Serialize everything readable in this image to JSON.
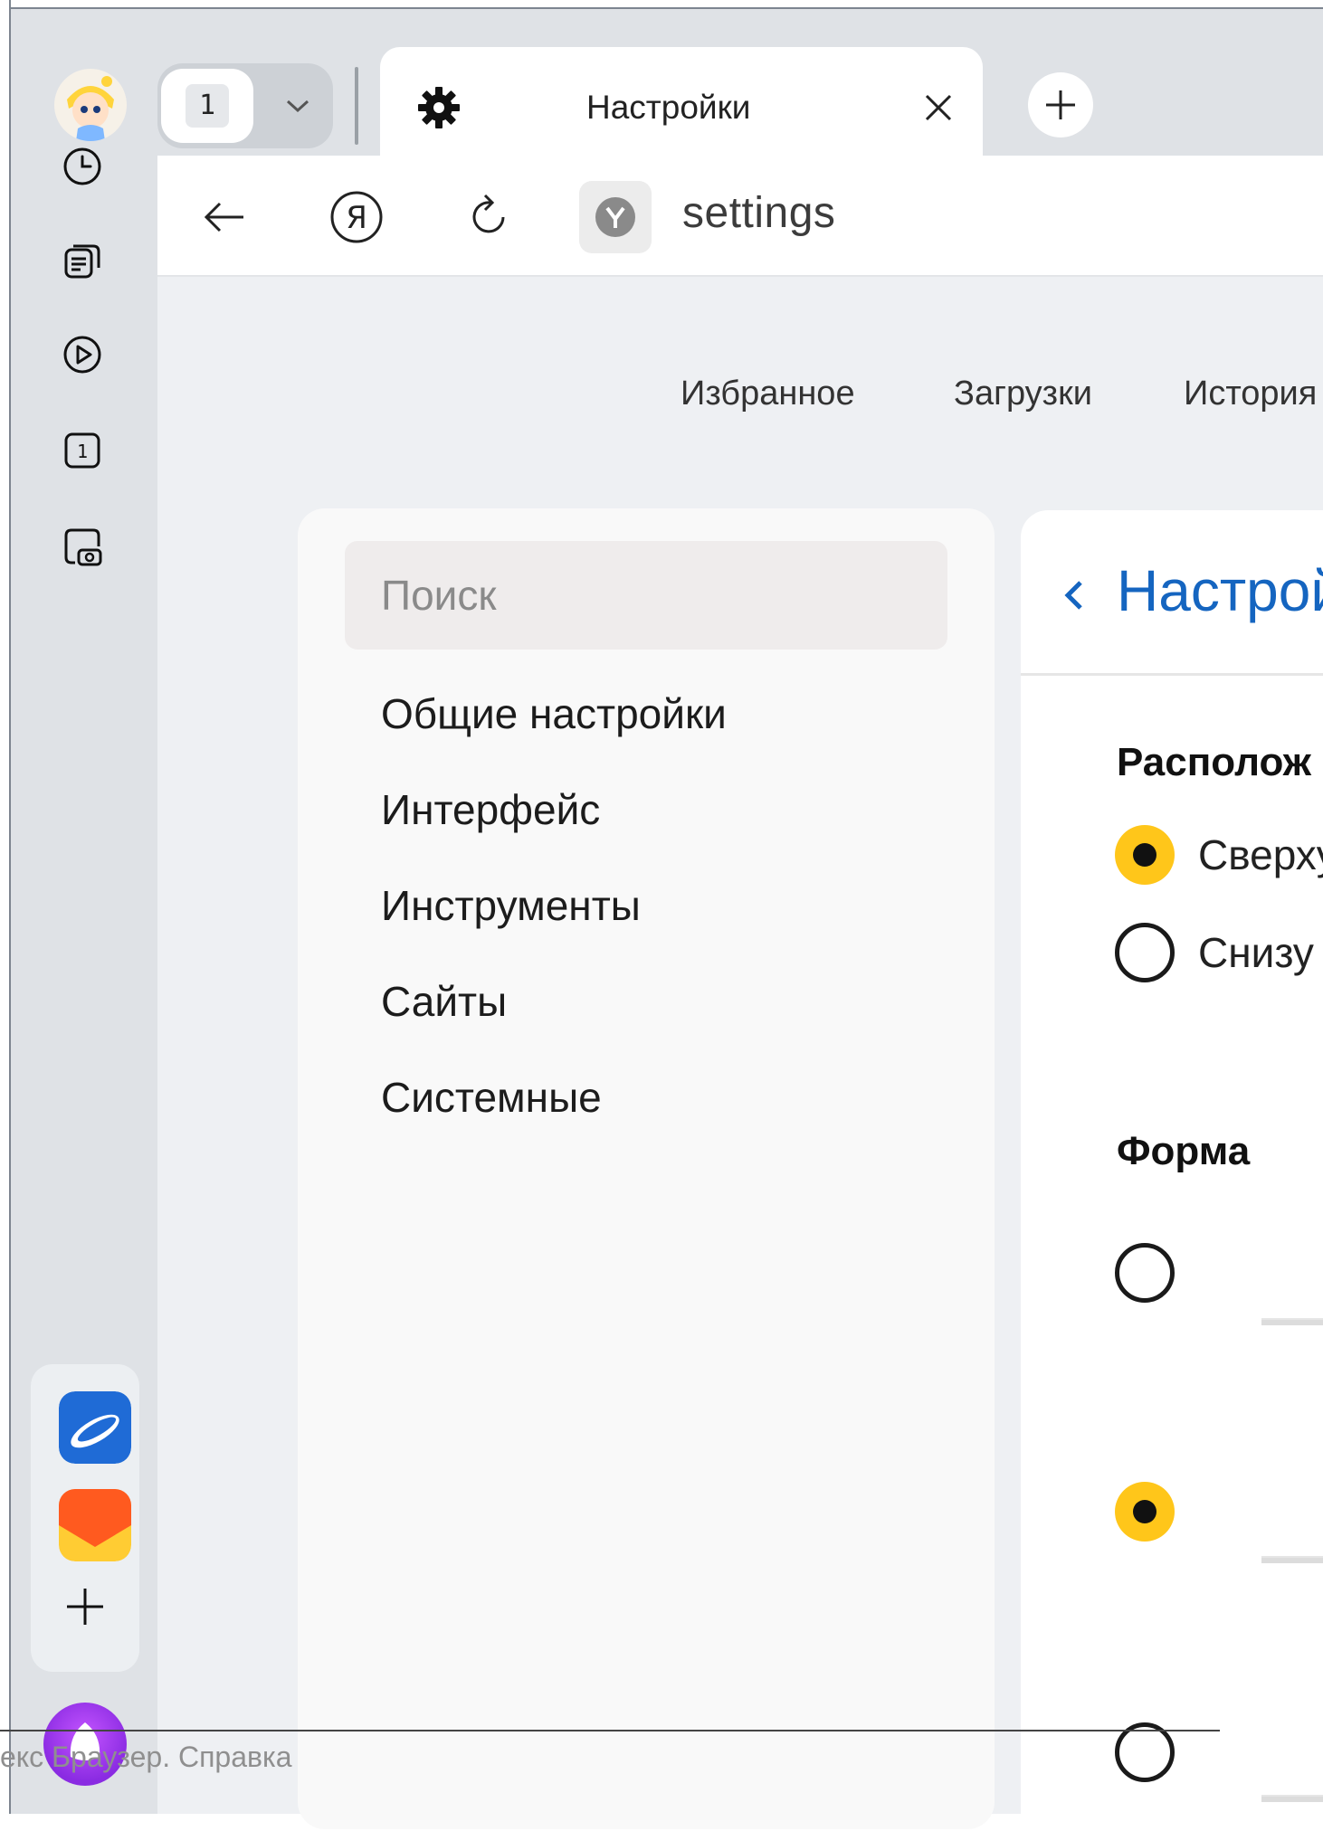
{
  "tabs": {
    "count": "1",
    "active": {
      "title": "Настройки"
    }
  },
  "address": {
    "url": "settings"
  },
  "topnav": [
    "Избранное",
    "Загрузки",
    "История"
  ],
  "search": {
    "placeholder": "Поиск"
  },
  "menu": [
    "Общие настройки",
    "Интерфейс",
    "Инструменты",
    "Сайты",
    "Системные"
  ],
  "panel": {
    "title": "Настрой",
    "position_title": "Располож",
    "options": [
      {
        "label": "Сверху",
        "selected": true
      },
      {
        "label": "Снизу",
        "selected": false
      }
    ],
    "shape_title": "Форма",
    "shape_options": [
      {
        "selected": false
      },
      {
        "selected": true
      },
      {
        "selected": false
      }
    ]
  },
  "status": {
    "text": "екс Браузер. Справка"
  },
  "icons": {
    "sidebar": [
      "avatar",
      "history-icon",
      "collections-icon",
      "video-icon",
      "tab-number-icon",
      "screenshot-icon",
      "disk-app-icon",
      "mail-app-icon",
      "add-app-icon",
      "alice-icon"
    ],
    "toolbar": [
      "back-icon",
      "yandex-icon",
      "reload-icon",
      "site-icon"
    ]
  },
  "colors": {
    "accent_yellow": "#ffc61a",
    "link_blue": "#1565c0",
    "sidebar_bg": "#dfe2e6"
  }
}
